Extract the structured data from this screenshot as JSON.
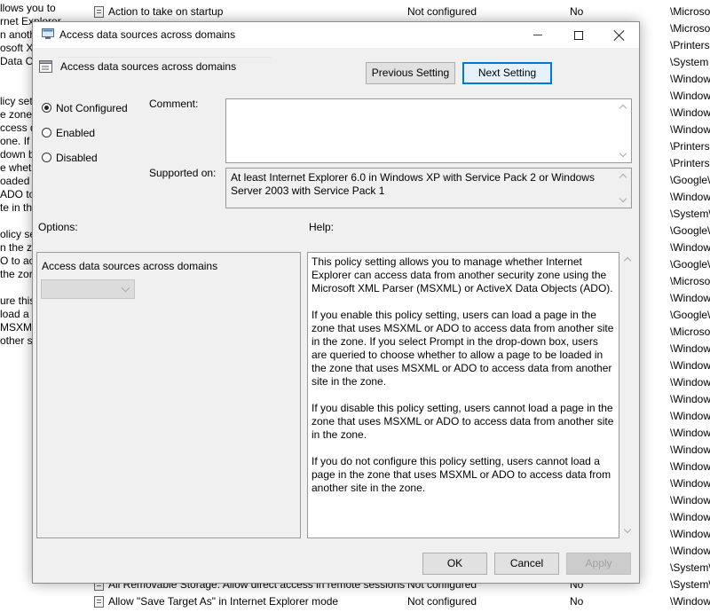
{
  "background": {
    "left_fragments": [
      "llows you to",
      "rnet Explorer",
      "n anoth",
      "osoft XI",
      " Data O",
      "",
      "licy set",
      "e zone",
      "ccess d",
      "one. If y",
      "down b",
      "e wheth",
      "oaded in",
      " ADO to",
      "te in th",
      "",
      "olicy set",
      "n the zo",
      "O to acc",
      "the zor",
      "",
      "ure this",
      "load a",
      "MSXML",
      "other si"
    ],
    "rows": [
      {
        "name": "Action to take on startup",
        "state": "Not configured",
        "comment": "No"
      },
      {
        "name": "All Removable Storage: Allow direct access in remote sessions",
        "state": "Not configured",
        "comment": "No"
      },
      {
        "name": "Allow \"Save Target As\" in Internet Explorer mode",
        "state": "Not configured",
        "comment": "No"
      }
    ],
    "paths": [
      "\\Microso",
      "\\Microso",
      "\\Printers",
      "\\System",
      "\\Window",
      "\\Window",
      "\\Window",
      "\\Window",
      "\\Printers",
      "\\Printers",
      "\\Google\\",
      "\\Window",
      "\\System\\",
      "\\Google\\",
      "\\Window",
      "\\Google\\",
      "\\Microso",
      "\\Window",
      "\\Google\\",
      "\\Microso",
      "\\Window",
      "\\Window",
      "\\Window",
      "\\Window",
      "\\Window",
      "\\Window",
      "\\Window",
      "\\Window",
      "\\Window",
      "\\Window",
      "\\Window",
      "\\Window",
      "\\Window",
      "\\System\\",
      "\\System\\",
      "\\Window"
    ]
  },
  "dialog": {
    "title": "Access data sources across domains",
    "header_title": "Access data sources across domains",
    "prev_button": "Previous Setting",
    "next_button": "Next Setting",
    "radios": [
      {
        "label": "Not Configured",
        "checked": true
      },
      {
        "label": "Enabled",
        "checked": false
      },
      {
        "label": "Disabled",
        "checked": false
      }
    ],
    "comment_label": "Comment:",
    "comment_value": "",
    "supported_label": "Supported on:",
    "supported_text": "At least Internet Explorer 6.0 in Windows XP with Service Pack 2 or Windows Server 2003 with Service Pack 1",
    "options_label": "Options:",
    "help_label": "Help:",
    "options_setting_title": "Access data sources across domains",
    "options_dropdown_value": "",
    "help_paragraphs": [
      "This policy setting allows you to manage whether Internet Explorer can access data from another security zone using the Microsoft XML Parser (MSXML) or ActiveX Data Objects (ADO).",
      "If you enable this policy setting, users can load a page in the zone that uses MSXML or ADO to access data from another site in the zone. If you select Prompt in the drop-down box, users are queried to choose whether to allow a page to be loaded in the zone that uses MSXML or ADO to access data from another site in the zone.",
      "If you disable this policy setting, users cannot load a page in the zone that uses MSXML or ADO to access data from another site in the zone.",
      "If you do not configure this policy setting, users cannot load a page in the zone that uses MSXML or ADO to access data from another site in the zone."
    ],
    "ok_button": "OK",
    "cancel_button": "Cancel",
    "apply_button": "Apply"
  },
  "colors": {
    "dialog_bg": "#f0f0f0",
    "primary_border": "#0078d7",
    "disabled_text": "#a0a0a0"
  }
}
